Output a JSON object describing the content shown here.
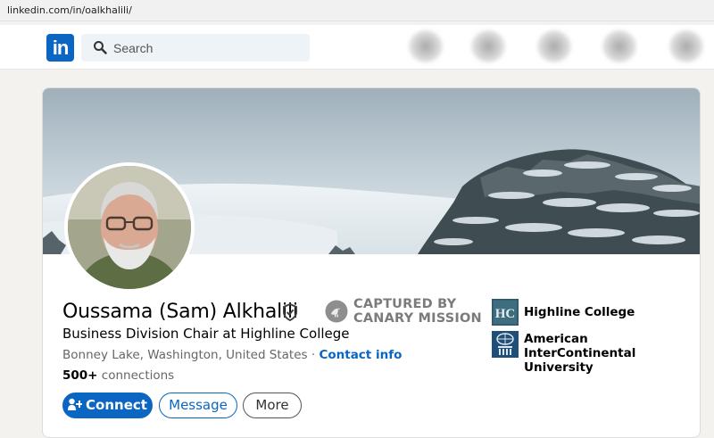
{
  "browser": {
    "url": "linkedin.com/in/oalkhalili/"
  },
  "nav": {
    "logo_text": "in",
    "search_placeholder": "Search",
    "search_icon": "search-icon"
  },
  "profile": {
    "name": "Oussama (Sam) Alkhalili",
    "headline": "Business Division Chair at Highline College",
    "location": "Bonney Lake, Washington, United States",
    "separator": " · ",
    "contact_info": "Contact info",
    "connections_count": "500+",
    "connections_label": " connections",
    "verified_icon": "shield-check-icon"
  },
  "actions": {
    "connect": "Connect",
    "message": "Message",
    "more": "More"
  },
  "watermark": {
    "line1": "CAPTURED BY",
    "line2": "CANARY MISSION"
  },
  "education": [
    {
      "name": "Highline College",
      "logo_text": "HC"
    },
    {
      "name": "American InterContinental University"
    }
  ],
  "colors": {
    "brand": "#0a66c2",
    "page_bg": "#f3f2ef",
    "muted_text": "#666666"
  }
}
